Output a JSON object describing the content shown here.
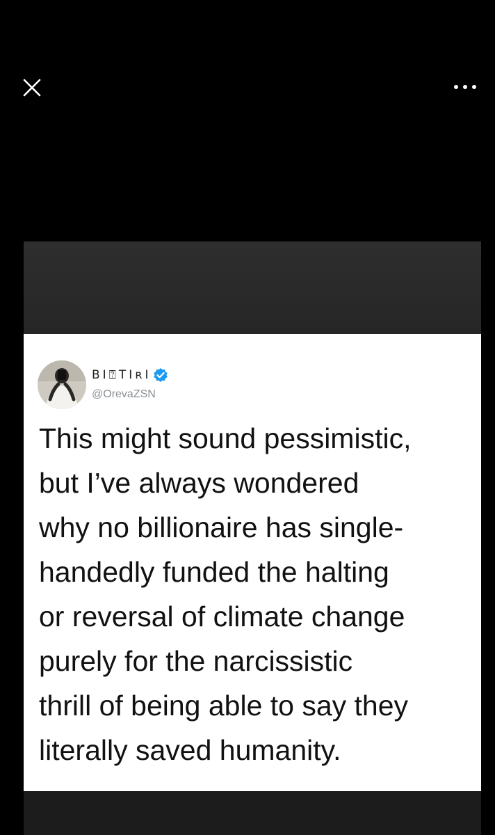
{
  "viewer": {
    "close_icon": "close-icon",
    "more_icon": "more-options-icon"
  },
  "tweet": {
    "display_name": "BI⍰TIʀI",
    "handle": "@OrevaZSN",
    "verified": true,
    "verified_color": "#1d9bf0",
    "text_lines": [
      "This might sound pessimistic,",
      "but I’ve always wondered",
      "why no billionaire has single-",
      "handedly funded the halting",
      "or reversal of climate change",
      "purely for the narcissistic",
      "thrill of being able to say they",
      "literally saved humanity."
    ]
  }
}
